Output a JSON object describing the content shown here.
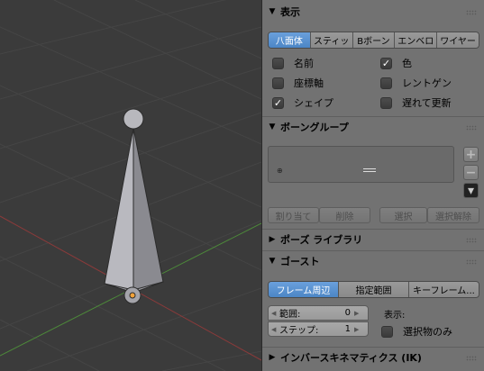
{
  "display_panel": {
    "title": "表示",
    "modes": [
      {
        "label": "八面体",
        "active": true
      },
      {
        "label": "スティッ",
        "active": false
      },
      {
        "label": "Bボーン",
        "active": false
      },
      {
        "label": "エンベロ",
        "active": false
      },
      {
        "label": "ワイヤー",
        "active": false
      }
    ],
    "options": [
      {
        "label": "名前",
        "checked": false
      },
      {
        "label": "色",
        "checked": true
      },
      {
        "label": "座標軸",
        "checked": false
      },
      {
        "label": "レントゲン",
        "checked": false
      },
      {
        "label": "シェイプ",
        "checked": true
      },
      {
        "label": "遅れて更新",
        "checked": false
      }
    ]
  },
  "bone_groups_panel": {
    "title": "ボーングループ",
    "add_label": "+",
    "remove_label": "−",
    "buttons": {
      "assign": "割り当て",
      "remove": "削除",
      "select": "選択",
      "deselect": "選択解除"
    }
  },
  "pose_library_panel": {
    "title": "ポーズ ライブラリ"
  },
  "ghost_panel": {
    "title": "ゴースト",
    "modes": [
      {
        "label": "フレーム周辺",
        "active": true
      },
      {
        "label": "指定範囲",
        "active": false
      },
      {
        "label": "キーフレーム...",
        "active": false
      }
    ],
    "range_label": "範囲:",
    "range_value": "0",
    "step_label": "ステップ:",
    "step_value": "1",
    "display_label": "表示:",
    "selected_only_label": "選択物のみ",
    "selected_only_checked": false
  },
  "ik_panel": {
    "title": "インバースキネマティクス (IK)"
  },
  "colors": {
    "active": "#5a92d2",
    "panel_bg": "#727272",
    "viewport_bg": "#3b3b3b"
  }
}
